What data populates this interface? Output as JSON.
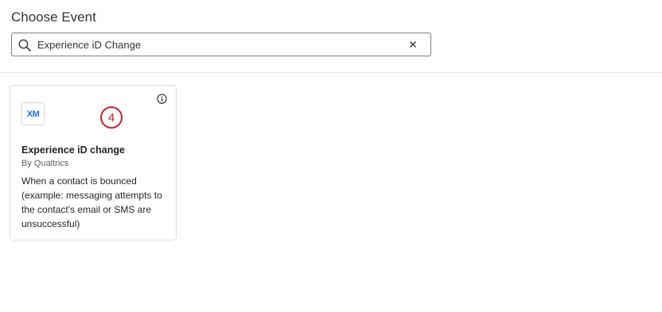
{
  "page": {
    "title": "Choose Event"
  },
  "search": {
    "value": "Experience iD Change",
    "icons": {
      "search": "search-icon",
      "clear": "close-icon"
    }
  },
  "cards": [
    {
      "logo_text": "XM",
      "logo_color": "#1a73e8",
      "name": "Experience iD change",
      "provider": "By Qualtrics",
      "description": "When a contact is bounced (example: messaging attempts to the contact's email or SMS are unsuccessful)",
      "step_badge": "4",
      "step_badge_color": "#c9202f",
      "icons": {
        "info": "info-icon"
      }
    }
  ]
}
